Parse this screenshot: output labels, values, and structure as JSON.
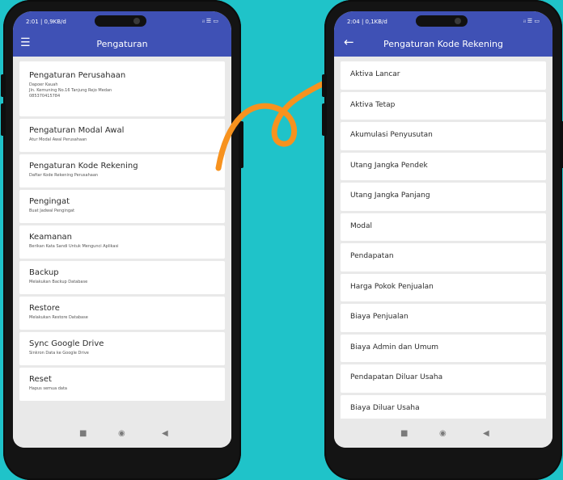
{
  "left_phone": {
    "status_time": "2:01 | 0,9KB/d",
    "status_icons": "ᵢₗ ☰ ▭",
    "title": "Pengaturan",
    "menu_icon": "menu-icon",
    "items": [
      {
        "title": "Pengaturan Perusahaan",
        "lines": [
          "Dapoer Kauah",
          "Jln. Kemuning No.16 Tanjung Rejo Medan",
          "085370415784"
        ]
      },
      {
        "title": "Pengaturan Modal Awal",
        "lines": [
          "Atur Modal Awal Perusahaan"
        ]
      },
      {
        "title": "Pengaturan Kode Rekening",
        "lines": [
          "Daftar Kode Rekening Perusahaan"
        ]
      },
      {
        "title": "Pengingat",
        "lines": [
          "Buat Jadwal Pengingat"
        ]
      },
      {
        "title": "Keamanan",
        "lines": [
          "Berikan Kata Sandi Untuk Mengunci Aplikasi"
        ]
      },
      {
        "title": "Backup",
        "lines": [
          "Melakukan Backup Database"
        ]
      },
      {
        "title": "Restore",
        "lines": [
          "Melakukan Restore Database"
        ]
      },
      {
        "title": "Sync Google Drive",
        "lines": [
          "Sinkron Data ke Google Drive"
        ]
      },
      {
        "title": "Reset",
        "lines": [
          "Hapus semua data"
        ]
      }
    ]
  },
  "right_phone": {
    "status_time": "2:04 | 0,1KB/d",
    "status_icons": "ᵢₗ ☰ ▭",
    "title": "Pengaturan Kode Rekening",
    "back_icon": "back-arrow-icon",
    "items": [
      "Aktiva Lancar",
      "Aktiva Tetap",
      "Akumulasi Penyusutan",
      "Utang Jangka Pendek",
      "Utang Jangka Panjang",
      "Modal",
      "Pendapatan",
      "Harga Pokok Penjualan",
      "Biaya Penjualan",
      "Biaya Admin dan Umum",
      "Pendapatan Diluar Usaha",
      "Biaya Diluar Usaha"
    ]
  },
  "nav_icons": {
    "square": "■",
    "home": "◉",
    "back": "◀"
  },
  "colors": {
    "background": "#1fc3c9",
    "appbar": "#3f51b5",
    "arrow": "#f7921e"
  }
}
